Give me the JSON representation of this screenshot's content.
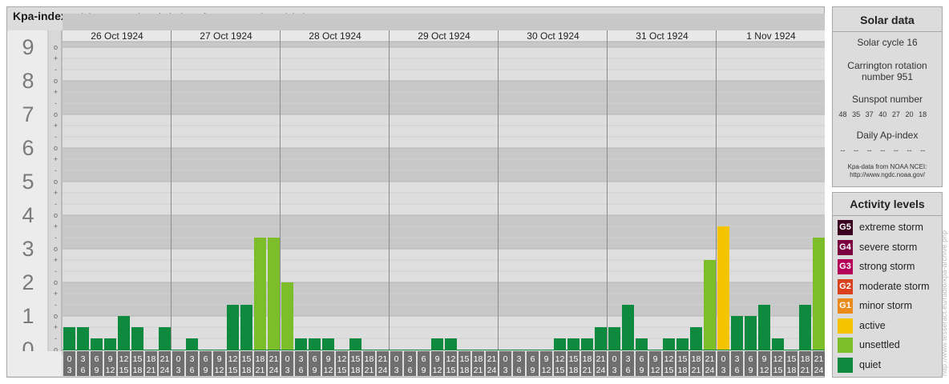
{
  "header": {
    "title": "Kpa-index",
    "subtitle": "(planetary 3-hourly index of geomagnetic activity)"
  },
  "chart_data": {
    "type": "bar",
    "y_major_labels": [
      "0",
      "1",
      "2",
      "3",
      "4",
      "5",
      "6",
      "7",
      "8",
      "9"
    ],
    "y_minor_labels": [
      "+",
      "o",
      "-"
    ],
    "ylim": [
      0,
      9.333
    ],
    "days": [
      "26 Oct 1924",
      "27 Oct 1924",
      "28 Oct 1924",
      "29 Oct 1924",
      "30 Oct 1924",
      "31 Oct 1924",
      "1 Nov 1924"
    ],
    "interval_start_labels": [
      "0",
      "3",
      "6",
      "9",
      "12",
      "15",
      "18",
      "21"
    ],
    "interval_end_labels": [
      "3",
      "6",
      "9",
      "12",
      "15",
      "18",
      "21",
      "24"
    ],
    "values": [
      [
        0.667,
        0.667,
        0.333,
        0.333,
        1.0,
        0.667,
        0,
        0.667
      ],
      [
        0,
        0.333,
        0,
        0,
        1.333,
        1.333,
        3.333,
        3.333
      ],
      [
        2.0,
        0.333,
        0.333,
        0.333,
        0,
        0.333,
        0,
        0
      ],
      [
        0,
        0,
        0,
        0.333,
        0.333,
        0,
        0,
        0
      ],
      [
        0,
        0,
        0,
        0,
        0.333,
        0.333,
        0.333,
        0.667
      ],
      [
        0.667,
        1.333,
        0.333,
        0,
        0.333,
        0.333,
        0.667,
        2.667
      ],
      [
        3.667,
        1.0,
        1.0,
        1.333,
        0.333,
        0,
        1.333,
        3.333
      ]
    ],
    "colors": {
      "quiet": "#0e8a3e",
      "unsettled": "#7cbd2a",
      "active": "#f5c400"
    }
  },
  "solar": {
    "title": "Solar data",
    "cycle": "Solar cycle 16",
    "carrington_line1": "Carrington rotation",
    "carrington_line2": "number 951",
    "sunspot_title": "Sunspot number",
    "sunspot_values": [
      "48",
      "35",
      "37",
      "40",
      "27",
      "20",
      "18"
    ],
    "ap_title": "Daily Ap-index",
    "ap_values": [
      "--",
      "--",
      "--",
      "--",
      "--",
      "--",
      "--"
    ],
    "source_line1": "Kpa-data from NOAA NCEI:",
    "source_line2": "http://www.ngdc.noaa.gov/"
  },
  "activity": {
    "title": "Activity levels",
    "levels": [
      {
        "code": "G5",
        "label": "extreme storm",
        "color": "#3a0020"
      },
      {
        "code": "G4",
        "label": "severe storm",
        "color": "#7a0040"
      },
      {
        "code": "G3",
        "label": "strong storm",
        "color": "#b5005a"
      },
      {
        "code": "G2",
        "label": "moderate storm",
        "color": "#d8401e"
      },
      {
        "code": "G1",
        "label": "minor storm",
        "color": "#ea8a1a"
      },
      {
        "code": "",
        "label": "active",
        "color": "#f5c400"
      },
      {
        "code": "",
        "label": "unsettled",
        "color": "#7cbd2a"
      },
      {
        "code": "",
        "label": "quiet",
        "color": "#0e8a3e"
      }
    ]
  },
  "credit": "http://www.tesseract.eu/radio/kpa-archive.php"
}
